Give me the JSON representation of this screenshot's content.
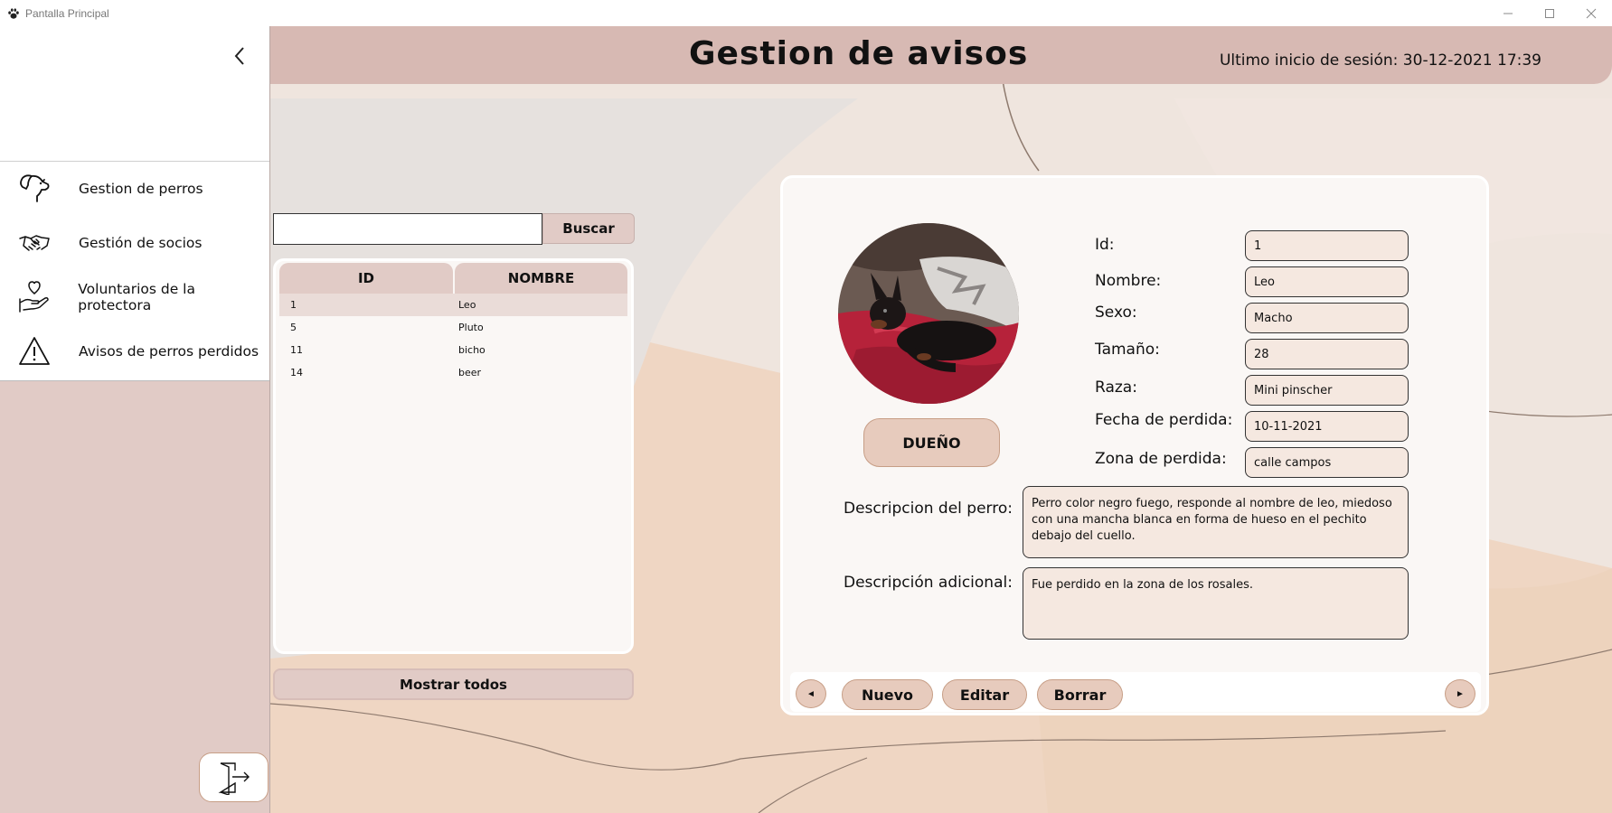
{
  "window": {
    "title": "Pantalla Principal",
    "app_icon": "paw-icon",
    "controls": [
      "minimize-icon",
      "maximize-icon",
      "close-icon"
    ]
  },
  "sidebar": {
    "back_icon": "chevron-left-icon",
    "items": [
      {
        "label": "Gestion de perros",
        "icon": "dog-icon"
      },
      {
        "label": "Gestión de socios",
        "icon": "handshake-icon"
      },
      {
        "label": "Voluntarios de la protectora",
        "icon": "heart-hand-icon"
      },
      {
        "label": "Avisos de perros perdidos",
        "icon": "warning-icon"
      }
    ],
    "logout_icon": "logout-door-icon"
  },
  "header": {
    "title": "Gestion de avisos",
    "last_login": "Ultimo inicio de sesión: 30-12-2021 17:39"
  },
  "search": {
    "value": "",
    "button_label": "Buscar"
  },
  "table": {
    "headers": [
      "ID",
      "NOMBRE"
    ],
    "rows": [
      {
        "id": "1",
        "nombre": "Leo"
      },
      {
        "id": "5",
        "nombre": "Pluto"
      },
      {
        "id": "11",
        "nombre": "bicho"
      },
      {
        "id": "14",
        "nombre": "beer"
      }
    ],
    "selected_index": 0
  },
  "show_all_label": "Mostrar todos",
  "detail": {
    "owner_button": "DUEÑO",
    "fields": {
      "id": {
        "label": "Id:",
        "value": "1"
      },
      "nombre": {
        "label": "Nombre:",
        "value": "Leo"
      },
      "sexo": {
        "label": "Sexo:",
        "value": "Macho"
      },
      "tamano": {
        "label": "Tamaño:",
        "value": "28"
      },
      "raza": {
        "label": "Raza:",
        "value": "Mini pinscher"
      },
      "fecha": {
        "label": "Fecha de perdida:",
        "value": "10-11-2021"
      },
      "zona": {
        "label": "Zona de perdida:",
        "value": "calle campos"
      }
    },
    "descripcion_perro": {
      "label": "Descripcion del perro:",
      "value": "Perro color negro fuego, responde al nombre de leo, miedoso con una mancha blanca en forma de hueso en el pechito debajo del cuello."
    },
    "descripcion_adicional": {
      "label": "Descripción adicional:",
      "value": "Fue perdido en la zona de los rosales."
    }
  },
  "footer": {
    "prev": "◄",
    "next": "►",
    "nuevo": "Nuevo",
    "editar": "Editar",
    "borrar": "Borrar"
  },
  "colors": {
    "header": "#d7b9b3",
    "sidebar": "#e1cbc6",
    "button": "#e7cbbd",
    "button_border": "#c79e86",
    "field": "#f5e8e0"
  }
}
